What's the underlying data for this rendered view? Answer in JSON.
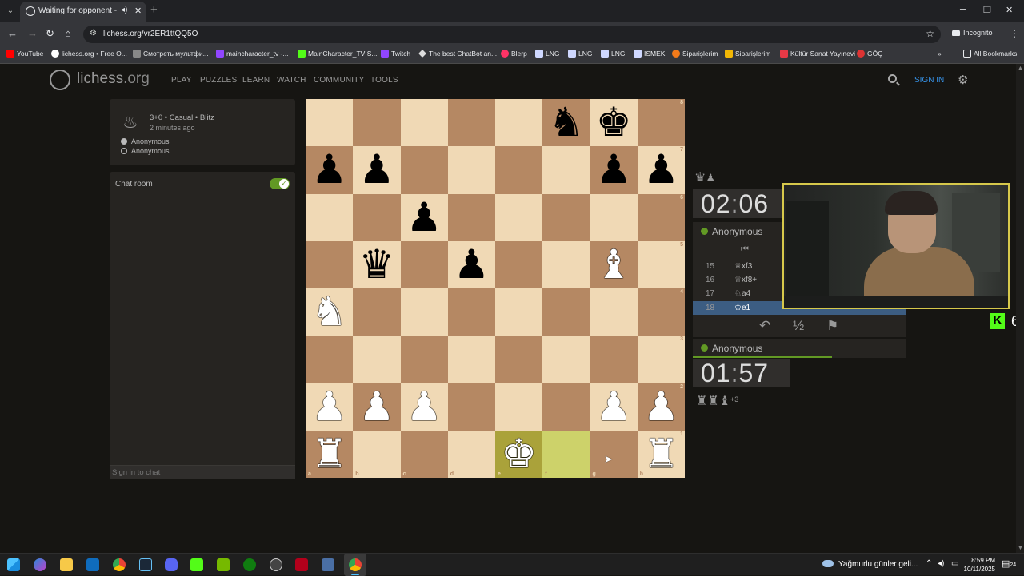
{
  "browser": {
    "tab_title": "Waiting for opponent - Pla",
    "url": "lichess.org/vr2ER1ttQQ5O",
    "incognito_label": "Incognito",
    "bookmarks": [
      {
        "label": "YouTube",
        "color": "#ff0000"
      },
      {
        "label": "lichess.org • Free O...",
        "color": "#ffffff"
      },
      {
        "label": "Смотреть мультфи...",
        "color": "#888888"
      },
      {
        "label": "maincharacter_tv -...",
        "color": "#9146ff"
      },
      {
        "label": "MainCharacter_TV S...",
        "color": "#53fc18"
      },
      {
        "label": "Twitch",
        "color": "#9146ff"
      },
      {
        "label": "The best ChatBot an...",
        "color": "#dddddd"
      },
      {
        "label": "Blerp",
        "color": "#ff3366"
      },
      {
        "label": "LNG",
        "color": "#cfd8ff"
      },
      {
        "label": "LNG",
        "color": "#cfd8ff"
      },
      {
        "label": "LNG",
        "color": "#cfd8ff"
      },
      {
        "label": "ISMEK",
        "color": "#cfd8ff"
      },
      {
        "label": "Siparişlerim",
        "color": "#f27a1a"
      },
      {
        "label": "Siparişlerim",
        "color": "#f2b705"
      },
      {
        "label": "Kültür Sanat Yayınevi",
        "color": "#e63946"
      },
      {
        "label": "GÖÇ",
        "color": "#d33"
      }
    ],
    "all_bookmarks": "All Bookmarks"
  },
  "site": {
    "logo": "lichess",
    "logo_tld": ".org",
    "nav": [
      "PLAY",
      "PUZZLES",
      "LEARN",
      "WATCH",
      "COMMUNITY",
      "TOOLS"
    ],
    "sign_in": "SIGN IN"
  },
  "game_info": {
    "mode": "3+0 • Casual • Blitz",
    "time_ago": "2 minutes ago",
    "players": [
      "Anonymous",
      "Anonymous"
    ]
  },
  "chat": {
    "title": "Chat room",
    "placeholder": "Sign in to chat"
  },
  "board": {
    "files": [
      "a",
      "b",
      "c",
      "d",
      "e",
      "f",
      "g",
      "h"
    ],
    "ranks": [
      "8",
      "7",
      "6",
      "5",
      "4",
      "3",
      "2",
      "1"
    ],
    "position": [
      [
        "",
        "",
        "",
        "",
        "",
        "bn",
        "bk",
        ""
      ],
      [
        "bp",
        "bp",
        "",
        "",
        "",
        "",
        "bp",
        "bp"
      ],
      [
        "",
        "",
        "bp",
        "",
        "",
        "",
        "",
        ""
      ],
      [
        "",
        "bq",
        "",
        "bp",
        "",
        "",
        "wb",
        ""
      ],
      [
        "wn",
        "",
        "",
        "",
        "",
        "",
        "",
        ""
      ],
      [
        "",
        "",
        "",
        "",
        "",
        "",
        "",
        ""
      ],
      [
        "wp",
        "wp",
        "wp",
        "",
        "",
        "",
        "wp",
        "wp"
      ],
      [
        "wr",
        "",
        "",
        "",
        "wk",
        "",
        "",
        "wr"
      ]
    ],
    "last_move": [
      "e1",
      "f1"
    ]
  },
  "clocks": {
    "top": {
      "min": "02",
      "sec": "06",
      "player": "Anonymous"
    },
    "bottom": {
      "min": "01",
      "sec": "57",
      "player": "Anonymous"
    }
  },
  "moves": [
    {
      "num": "15",
      "san": "♕xf3"
    },
    {
      "num": "16",
      "san": "♕xf8+"
    },
    {
      "num": "17",
      "san": "♘a4"
    },
    {
      "num": "18",
      "san": "♔e1",
      "active": true
    }
  ],
  "controls": {
    "draw": "½"
  },
  "bottom_material": "+3",
  "overlay": {
    "kick_count": "6"
  },
  "taskbar": {
    "weather": "Yağmurlu günler geli...",
    "time": "8:59 PM",
    "date": "10/11/2025",
    "notifications": "24"
  }
}
